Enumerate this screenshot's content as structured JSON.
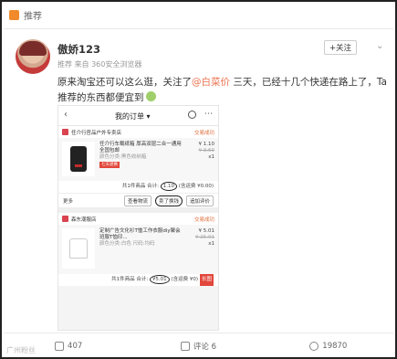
{
  "topbar": {
    "label": "推荐"
  },
  "post": {
    "username": "傲娇123",
    "meta": "推荐 来自 360安全浏览器",
    "follow_label": "+关注",
    "text_pre": "原来淘宝还可以这么逛，关注了",
    "mention": "@白菜价",
    "text_post": " 三天，已经十几个快递在路上了，Ta推荐的东西都便宜到"
  },
  "screenshot": {
    "title": "我的订单 ▾",
    "orders": [
      {
        "store": "任介行官品户外专卖店",
        "status": "交易成功",
        "desc": "任介行车载纸箱 厚高双层二合一通用 全国包邮",
        "spec": "颜色分类:黑色收纳箱",
        "tag": "七天退换",
        "price": "¥ 1.10",
        "old_price": "¥ 3.60",
        "qty": "x1",
        "sum_pre": "共1件商品 合计: ",
        "sum_amount": "1.10",
        "sum_post": " (含运费 ¥0.00)",
        "buttons": [
          "更多",
          "查看物流",
          "卖了换钱",
          "追加评价"
        ]
      },
      {
        "store": "森东潮服店",
        "status": "交易成功",
        "desc": "定制广告文化衫T恤工作衣服diy聚会班服T恤印...",
        "spec": "颜色分类:白色 尺码:均码",
        "tag": "",
        "price": "¥ 5.01",
        "old_price": "¥ 25.01",
        "qty": "x1",
        "sum_pre": "共1件商品 合计: ",
        "sum_amount": "¥5.01",
        "sum_post": " (含运费 ¥0)",
        "stamp": "长图",
        "buttons": []
      }
    ]
  },
  "bottom": {
    "repost": "407",
    "comment": "评论 6",
    "like": "19870"
  },
  "watermark": "广州粉丝"
}
